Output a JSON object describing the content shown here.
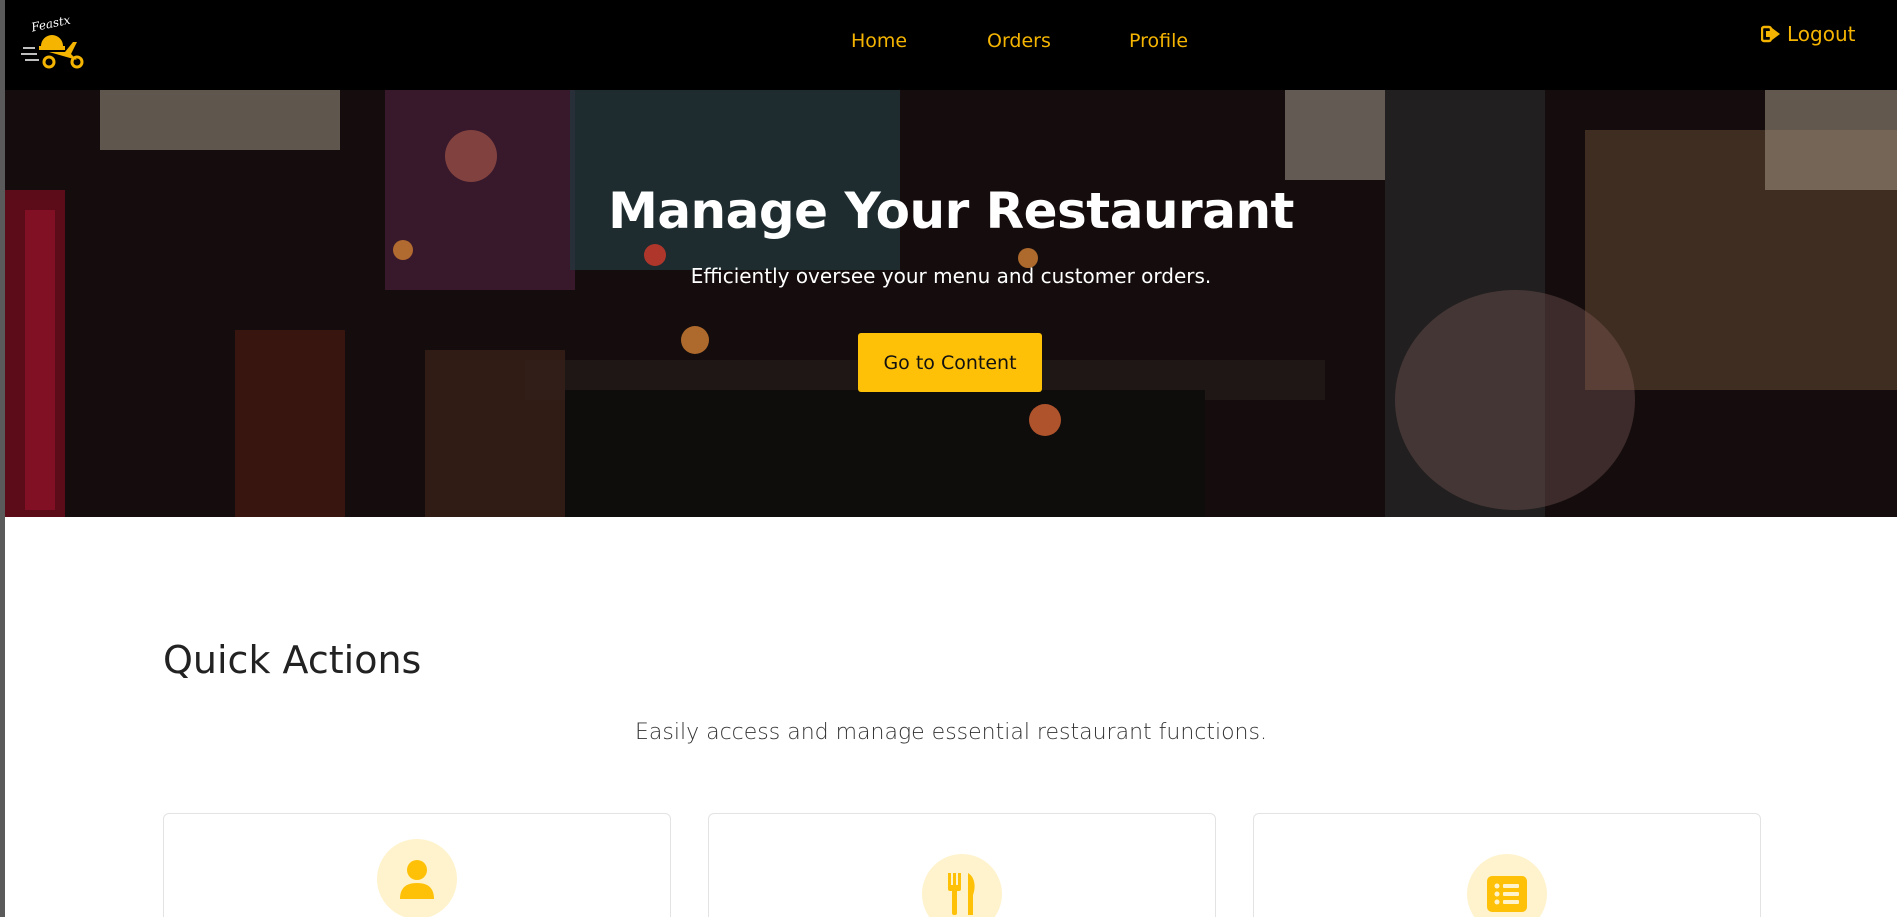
{
  "brand": {
    "logo_text": "Feastx",
    "logo_icon": "scooter-logo-icon"
  },
  "nav": {
    "links": [
      {
        "label": "Home"
      },
      {
        "label": "Orders"
      },
      {
        "label": "Profile"
      }
    ],
    "logout_label": "Logout",
    "logout_icon": "sign-out-icon"
  },
  "hero": {
    "title": "Manage Your Restaurant",
    "subtitle": "Efficiently oversee your menu and customer orders.",
    "button_label": "Go to Content"
  },
  "quick_actions": {
    "title": "Quick Actions",
    "subtitle": "Easily access and manage essential restaurant functions.",
    "cards": [
      {
        "icon": "user-icon"
      },
      {
        "icon": "utensils-icon"
      },
      {
        "icon": "list-icon"
      }
    ]
  },
  "colors": {
    "accent": "#ffc107",
    "nav_text": "#f4b400",
    "icon_bg": "#fff3cd",
    "navbar_bg": "#000000"
  }
}
